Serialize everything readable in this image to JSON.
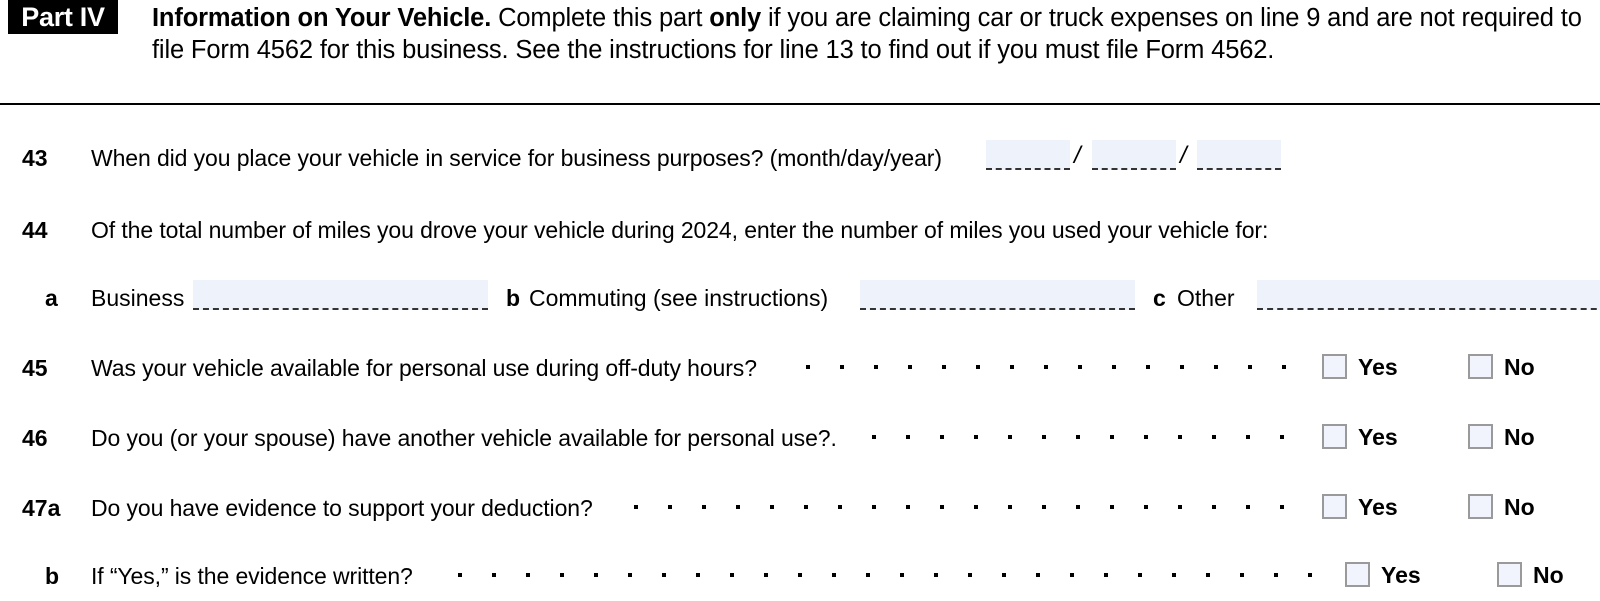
{
  "part": {
    "badge": "Part IV",
    "title": "Information on Your Vehicle.",
    "body_before_em": " Complete this part ",
    "emphasis": "only",
    "body_after_em": " if you are claiming car or truck expenses on line 9 and are not required to file Form 4562 for this business. See the instructions for line 13 to find out if you must file Form 4562."
  },
  "colors": {
    "field_fill": "#eef2fb",
    "field_rule": "#333333",
    "checkbox_border": "#9a9a9a",
    "checkbox_fill": "#f1f4fc",
    "badge_background": "#000000",
    "badge_text": "#ffffff"
  },
  "lines": {
    "l43": {
      "number": "43",
      "question": "When did you place your vehicle in service for business purposes? (month/day/year)",
      "month_value": "",
      "day_value": "",
      "year_value": "",
      "separator": "/"
    },
    "l44": {
      "number": "44",
      "question": "Of the total number of miles you drove your vehicle during 2024, enter the number of miles you used your vehicle for:",
      "a": {
        "marker": "a",
        "label": "Business",
        "value": ""
      },
      "b": {
        "marker": "b",
        "label": "Commuting (see instructions)",
        "value": ""
      },
      "c": {
        "marker": "c",
        "label": "Other",
        "value": ""
      }
    },
    "l45": {
      "number": "45",
      "question": "Was your vehicle available for personal use during off-duty hours?",
      "yes_label": "Yes",
      "no_label": "No",
      "yes_checked": false,
      "no_checked": false
    },
    "l46": {
      "number": "46",
      "question": "Do you (or your spouse) have another vehicle available for personal use?.",
      "yes_label": "Yes",
      "no_label": "No",
      "yes_checked": false,
      "no_checked": false
    },
    "l47a": {
      "number": "47a",
      "question": "Do you have evidence to support your deduction?",
      "yes_label": "Yes",
      "no_label": "No",
      "yes_checked": false,
      "no_checked": false
    },
    "l47b": {
      "number": "b",
      "question": "If “Yes,” is the evidence written?",
      "yes_label": "Yes",
      "no_label": "No",
      "yes_checked": false,
      "no_checked": false
    }
  }
}
